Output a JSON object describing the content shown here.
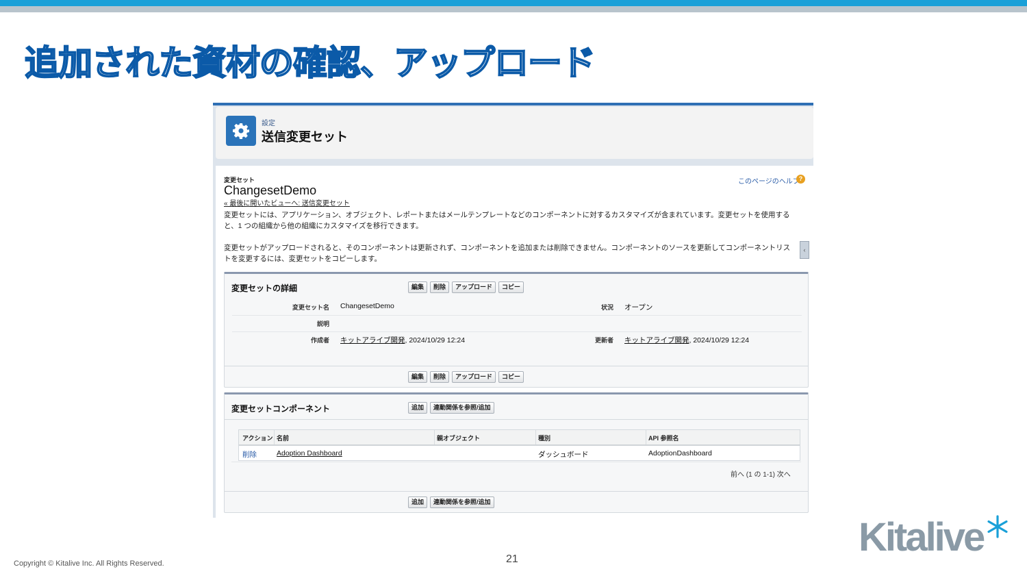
{
  "slide": {
    "title": "追加された資材の確認、アップロード",
    "copyright": "Copyright © Kitalive Inc. All Rights Reserved.",
    "page_number": "21",
    "logo_text": "Kitalive",
    "colors": {
      "top_bar": "#1aa0d8",
      "title_stroke": "#0b5aa8",
      "logo_gray": "#8a9aa6",
      "logo_star": "#1aa0d8"
    }
  },
  "screenshot": {
    "header": {
      "breadcrumb": "設定",
      "title": "送信変更セット",
      "icon": "gear-icon"
    },
    "changeset_label": "変更セット",
    "changeset_name": "ChangesetDemo",
    "back_link": "« 最後に開いたビューへ: 送信変更セット",
    "help_link": "このページのヘルプ",
    "help_icon": "?",
    "description_1_line1": "変更セットには、アプリケーション、オブジェクト、レポートまたはメールテンプレートなどのコンポーネントに対するカスタマイズが含まれています。変更セットを使用する",
    "description_1_line2": "と、1 つの組織から他の組織にカスタマイズを移行できます。",
    "description_2_line1": "変更セットがアップロードされると、そのコンポーネントは更新されず、コンポーネントを追加または削除できません。コンポーネントのソースを更新してコンポーネントリス",
    "description_2_line2": "トを変更するには、変更セットをコピーします。",
    "detail_section": {
      "title": "変更セットの詳細",
      "buttons": {
        "edit": "編集",
        "delete": "削除",
        "upload": "アップロード",
        "copy": "コピー"
      },
      "fields": {
        "name_label": "変更セット名",
        "name_value": "ChangesetDemo",
        "status_label": "状況",
        "status_value": "オープン",
        "description_label": "説明",
        "created_by_label": "作成者",
        "created_by_user": "キットアライブ開発",
        "created_by_date": ", 2024/10/29 12:24",
        "modified_by_label": "更新者",
        "modified_by_user": "キットアライブ開発",
        "modified_by_date": ", 2024/10/29 12:24"
      }
    },
    "component_section": {
      "title": "変更セットコンポーネント",
      "buttons": {
        "add": "追加",
        "view_add_dependencies": "連動関係を参照/追加"
      },
      "columns": {
        "action": "アクション",
        "name": "名前",
        "parent_object": "親オブジェクト",
        "type": "種別",
        "api_name": "API 参照名"
      },
      "rows": [
        {
          "action": "削除",
          "name": "Adoption Dashboard",
          "parent_object": "",
          "type": "ダッシュボード",
          "api_name": "AdoptionDashboard"
        }
      ],
      "pagination": "前へ (1 の 1-1) 次へ"
    }
  }
}
